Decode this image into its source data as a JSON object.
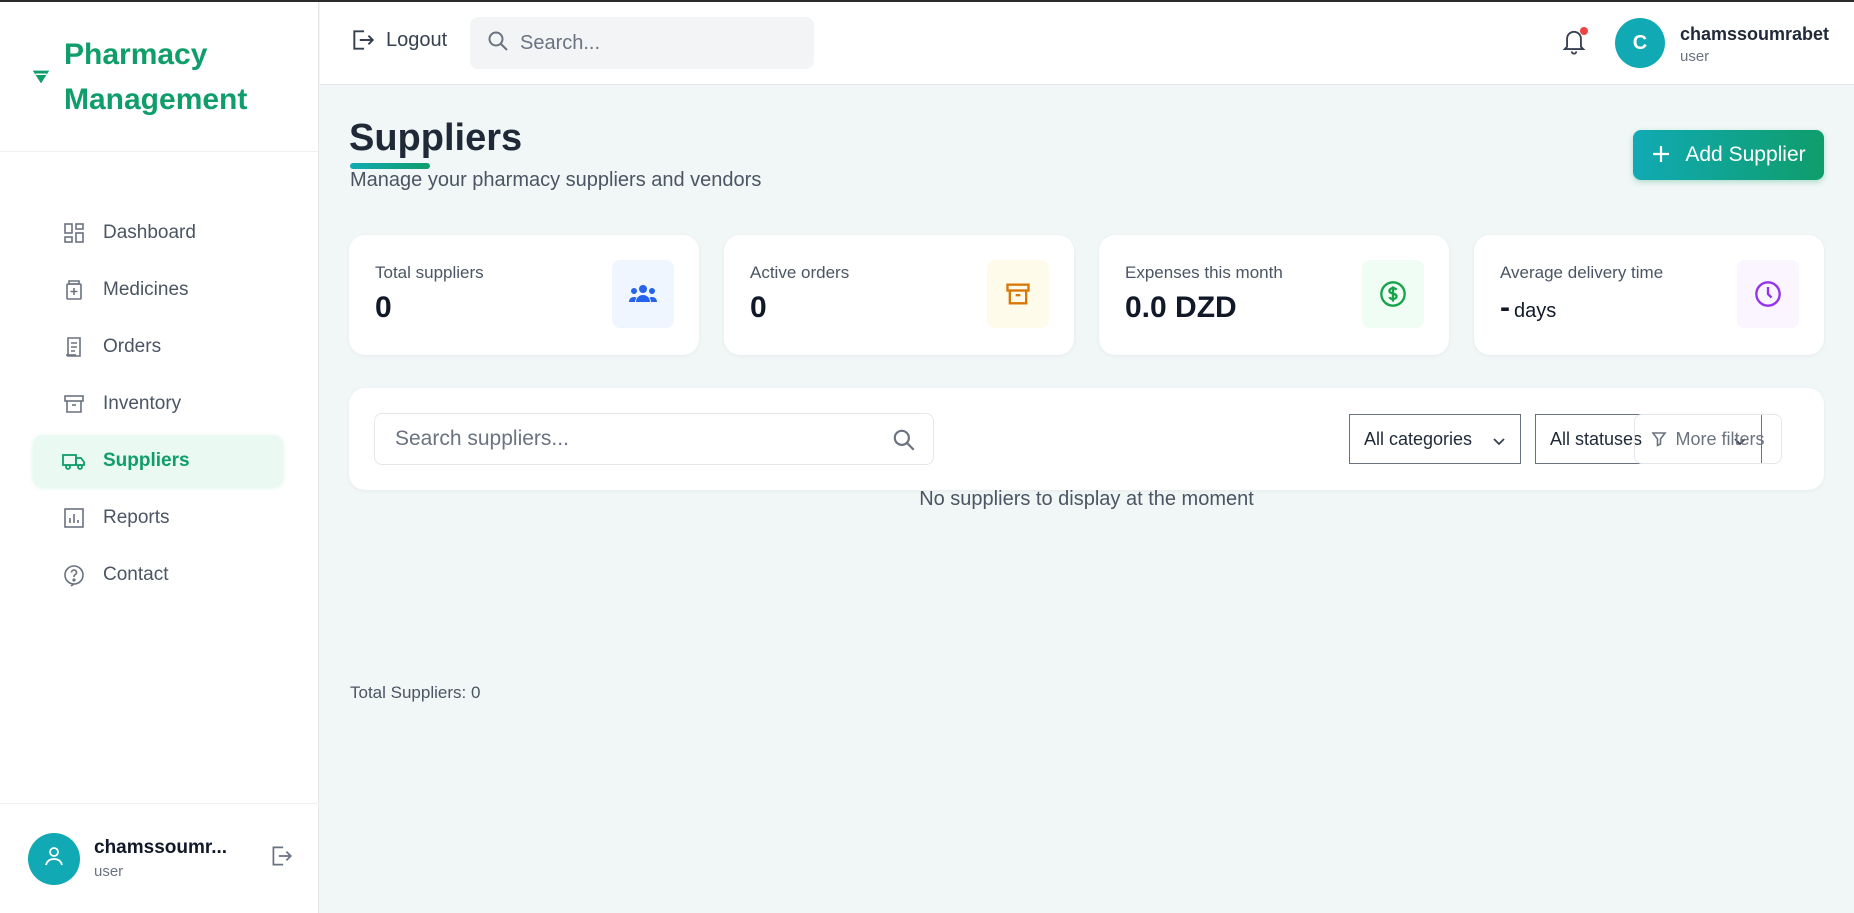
{
  "brand": {
    "name": "Pharmacy Management"
  },
  "nav": {
    "items": [
      {
        "label": "Dashboard",
        "icon": "dashboard-icon"
      },
      {
        "label": "Medicines",
        "icon": "medicine-icon"
      },
      {
        "label": "Orders",
        "icon": "receipt-icon"
      },
      {
        "label": "Inventory",
        "icon": "archive-icon"
      },
      {
        "label": "Suppliers",
        "icon": "truck-icon",
        "active": true
      },
      {
        "label": "Reports",
        "icon": "bar-chart-icon"
      },
      {
        "label": "Contact",
        "icon": "help-icon"
      }
    ]
  },
  "sidebar_user": {
    "name": "chamssoumr...",
    "role": "user"
  },
  "header": {
    "logout_label": "Logout",
    "search_placeholder": "Search...",
    "avatar_letter": "C",
    "user_name": "chamssoumrabet",
    "user_role": "user"
  },
  "page": {
    "title": "Suppliers",
    "subtitle": "Manage your pharmacy suppliers and vendors",
    "add_button": "Add Supplier"
  },
  "stats": [
    {
      "label": "Total suppliers",
      "value": "0",
      "unit": "",
      "icon": "users-icon",
      "color": "#2563eb",
      "bg": "#eff6ff"
    },
    {
      "label": "Active orders",
      "value": "0",
      "unit": "",
      "icon": "archive-box-icon",
      "color": "#d97706",
      "bg": "#fffbeb"
    },
    {
      "label": "Expenses this month",
      "value": "0.0 DZD",
      "unit": "",
      "icon": "dollar-circle-icon",
      "color": "#16a34a",
      "bg": "#f0fdf4"
    },
    {
      "label": "Average delivery time",
      "value": "-",
      "unit": "days",
      "icon": "clock-icon",
      "color": "#9333ea",
      "bg": "#faf5ff"
    }
  ],
  "filters": {
    "search_placeholder": "Search suppliers...",
    "category_selected": "All categories",
    "status_selected": "All statuses",
    "more_filters": "More filters"
  },
  "empty_message": "No suppliers to display at the moment",
  "total_label": "Total Suppliers: 0"
}
